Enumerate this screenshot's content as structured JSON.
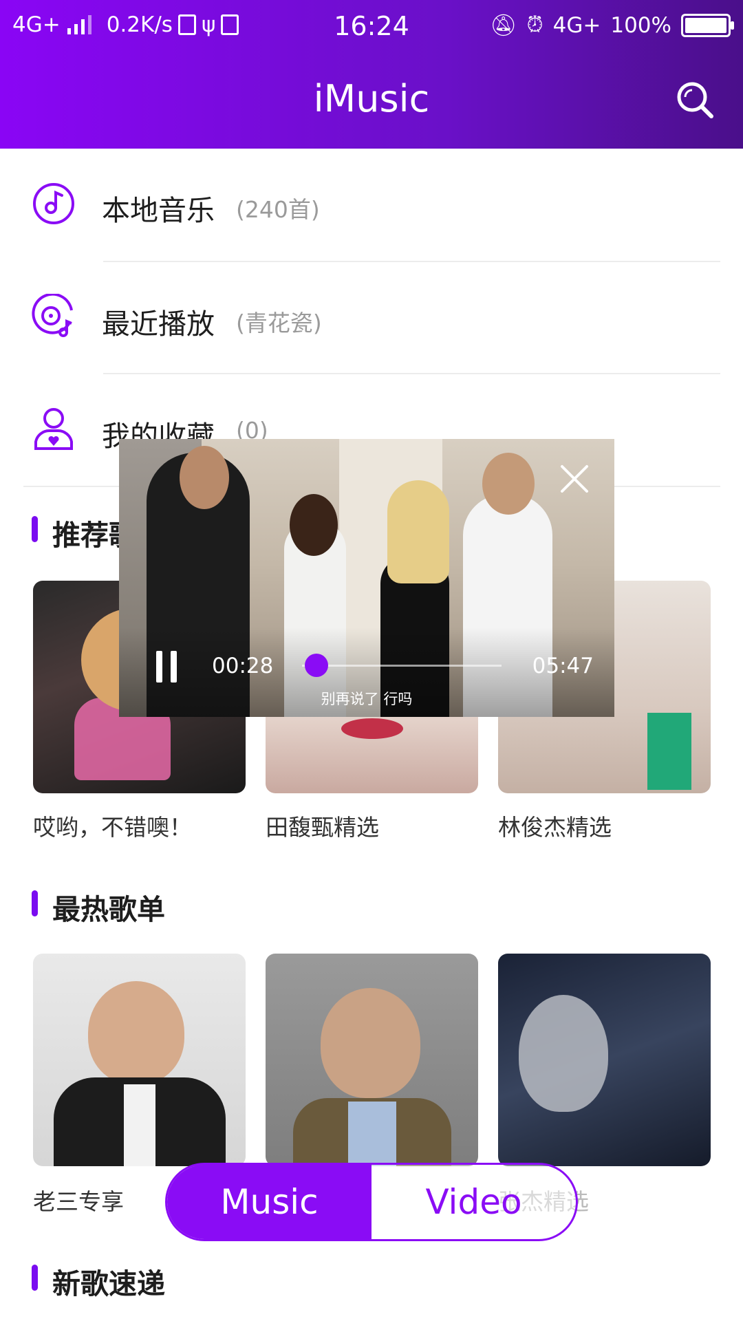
{
  "status_bar": {
    "network": "4G+",
    "speed": "0.2K/s",
    "time": "16:24",
    "network_right": "4G+",
    "battery": "100%"
  },
  "header": {
    "title": "iMusic"
  },
  "menu": [
    {
      "label": "本地音乐",
      "sub": "(240首)",
      "icon": "music-disc-icon"
    },
    {
      "label": "最近播放",
      "sub": "(青花瓷)",
      "icon": "recent-disc-icon"
    },
    {
      "label": "我的收藏",
      "sub": "(0)",
      "icon": "favorite-person-icon"
    }
  ],
  "sections": {
    "recommended": {
      "title": "推荐歌单",
      "items": [
        {
          "label": "哎哟，不错噢！"
        },
        {
          "label": "田馥甄精选"
        },
        {
          "label": "林俊杰精选"
        }
      ]
    },
    "hot": {
      "title": "最热歌单",
      "items": [
        {
          "label": "老三专享"
        },
        {
          "label": ""
        },
        {
          "label": "张杰精选"
        }
      ]
    },
    "new": {
      "title": "新歌速递"
    }
  },
  "video": {
    "current_time": "00:28",
    "total_time": "05:47",
    "subtitle": "别再说了 行吗",
    "progress": 0.08
  },
  "tabs": {
    "music": "Music",
    "video": "Video"
  },
  "colors": {
    "accent": "#8a0cf5",
    "header_start": "#8a05f5",
    "header_end": "#4a0f8a"
  }
}
